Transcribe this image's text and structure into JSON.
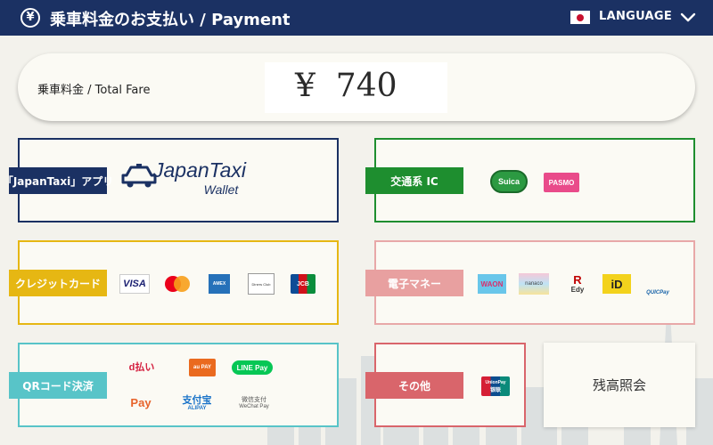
{
  "header": {
    "title": "乗車料金のお支払い / Payment",
    "yen_symbol": "¥",
    "language_label": "LANGUAGE"
  },
  "fare": {
    "label": "乗車料金 /  Total Fare",
    "amount": "¥  740"
  },
  "sections": {
    "japantaxi": {
      "tag": "「JapanTaxi」アプリ",
      "logo_main": "JapanTaxi",
      "logo_sub": "Wallet"
    },
    "transit_ic": {
      "tag": "交通系 IC",
      "logos": {
        "suica": "Suica",
        "pasmo": "PASMO"
      }
    },
    "credit": {
      "tag": "クレジットカード",
      "logos": {
        "visa": "VISA",
        "amex": "AMEX",
        "diners": "Diners Club",
        "jcb": "JCB"
      }
    },
    "emoney": {
      "tag": "電子マネー",
      "logos": {
        "waon": "WAON",
        "nanaco": "nanaco",
        "edy": "Edy",
        "id": "iD",
        "quicpay": "QUICPay"
      }
    },
    "qr": {
      "tag": "QRコード決済",
      "logos": {
        "dpay": "d払い",
        "aupay": "au PAY",
        "linepay": "LINE Pay",
        "origami": "Pay",
        "alipay_cn": "支付宝",
        "alipay": "ALIPAY",
        "wechat_cn": "微信支付",
        "wechat": "WeChat Pay"
      }
    },
    "other": {
      "tag": "その他",
      "logos": {
        "unionpay": "UnionPay",
        "unionpay_cn": "银联"
      }
    },
    "balance": {
      "label": "残高照会"
    }
  }
}
